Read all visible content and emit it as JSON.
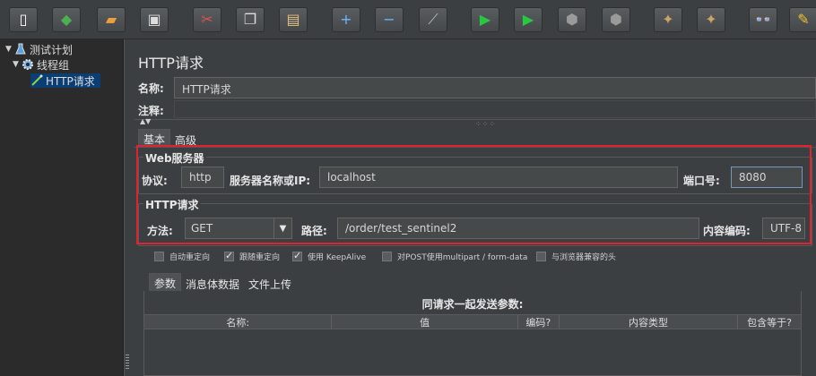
{
  "toolbar": {
    "buttons": [
      {
        "name": "new-icon",
        "glyph": "▯",
        "color": "#ffffff"
      },
      {
        "name": "templates-icon",
        "glyph": "◆",
        "color": "#4caf50"
      },
      {
        "name": "open-icon",
        "glyph": "▰",
        "color": "#e9a23b"
      },
      {
        "name": "save-icon",
        "glyph": "▣",
        "color": "#dddddd"
      },
      {
        "name": "cut-icon",
        "glyph": "✂",
        "color": "#e05252"
      },
      {
        "name": "copy-icon",
        "glyph": "❐",
        "color": "#dddddd"
      },
      {
        "name": "paste-icon",
        "glyph": "▤",
        "color": "#e6c07b"
      },
      {
        "name": "expand-icon",
        "glyph": "+",
        "color": "#6cb4ff"
      },
      {
        "name": "collapse-icon",
        "glyph": "−",
        "color": "#6cb4ff"
      },
      {
        "name": "toggle-icon",
        "glyph": "⟋",
        "color": "#bbbbbb"
      },
      {
        "name": "start-icon",
        "glyph": "▶",
        "color": "#27c93f"
      },
      {
        "name": "start-no-pauses-icon",
        "glyph": "▶",
        "color": "#27c93f"
      },
      {
        "name": "stop-icon",
        "glyph": "⬢",
        "color": "#9a9a9a"
      },
      {
        "name": "shutdown-icon",
        "glyph": "⬢",
        "color": "#9a9a9a"
      },
      {
        "name": "clear-icon",
        "glyph": "✦",
        "color": "#c9a36a"
      },
      {
        "name": "clear-all-icon",
        "glyph": "✦",
        "color": "#c9a36a"
      },
      {
        "name": "search-icon",
        "glyph": "👓",
        "color": "#dddddd"
      },
      {
        "name": "reset-search-icon",
        "glyph": "✎",
        "color": "#f2c230"
      }
    ]
  },
  "tree": {
    "test_plan": "测试计划",
    "thread_group": "线程组",
    "http_request": "HTTP请求"
  },
  "panel": {
    "title": "HTTP请求",
    "name_label": "名称:",
    "name_value": "HTTP请求",
    "comment_label": "注释:",
    "tabs": [
      "基本",
      "高级"
    ],
    "web_server": {
      "title": "Web服务器",
      "protocol_label": "协议:",
      "protocol_value": "http",
      "server_label": "服务器名称或IP:",
      "server_value": "localhost",
      "port_label": "端口号:",
      "port_value": "8080"
    },
    "http_request": {
      "title": "HTTP请求",
      "method_label": "方法:",
      "method_value": "GET",
      "path_label": "路径:",
      "path_value": "/order/test_sentinel2",
      "encoding_label": "内容编码:",
      "encoding_value": "UTF-8"
    },
    "options": [
      {
        "label": "自动重定向",
        "checked": false
      },
      {
        "label": "跟随重定向",
        "checked": true
      },
      {
        "label": "使用 KeepAlive",
        "checked": true
      },
      {
        "label": "对POST使用multipart / form-data",
        "checked": false
      },
      {
        "label": "与浏览器兼容的头",
        "checked": false
      }
    ],
    "sub_tabs": [
      "参数",
      "消息体数据",
      "文件上传"
    ],
    "params": {
      "caption": "同请求一起发送参数:",
      "columns": [
        "名称:",
        "值",
        "编码?",
        "内容类型",
        "包含等于?"
      ]
    }
  },
  "colors": {
    "highlight": "#e0232f",
    "selection": "#0b3f73"
  }
}
